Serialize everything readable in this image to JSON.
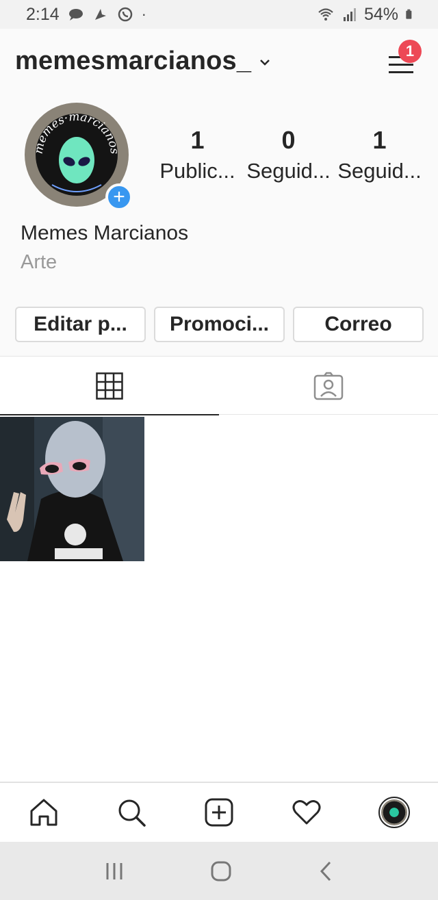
{
  "status_bar": {
    "time": "2:14",
    "battery": "54%",
    "icons": [
      "chat-bubble-icon",
      "location-arrow-icon",
      "whatsapp-icon",
      "dot-icon",
      "wifi-icon",
      "signal-icon",
      "battery-icon"
    ]
  },
  "header": {
    "username": "memesmarcianos_",
    "menu_badge_count": "1"
  },
  "profile": {
    "full_name": "Memes Marcianos",
    "category": "Arte",
    "avatar_text": "memes·marcianos",
    "stats": [
      {
        "number": "1",
        "label": "Public..."
      },
      {
        "number": "0",
        "label": "Seguid..."
      },
      {
        "number": "1",
        "label": "Seguid..."
      }
    ],
    "buttons": [
      {
        "label": "Editar p..."
      },
      {
        "label": "Promoci..."
      },
      {
        "label": "Correo"
      }
    ]
  },
  "tabs": [
    {
      "icon": "grid-icon",
      "active": true
    },
    {
      "icon": "tagged-person-icon",
      "active": false
    }
  ],
  "posts": [
    {
      "description": "alien mask photo"
    }
  ],
  "bottom_nav": [
    "home-icon",
    "search-icon",
    "new-post-icon",
    "heart-icon",
    "profile-avatar-icon"
  ],
  "colors": {
    "accent_blue": "#3897f0",
    "badge_red": "#ed4956",
    "text_primary": "#262626",
    "text_secondary": "#999999"
  }
}
